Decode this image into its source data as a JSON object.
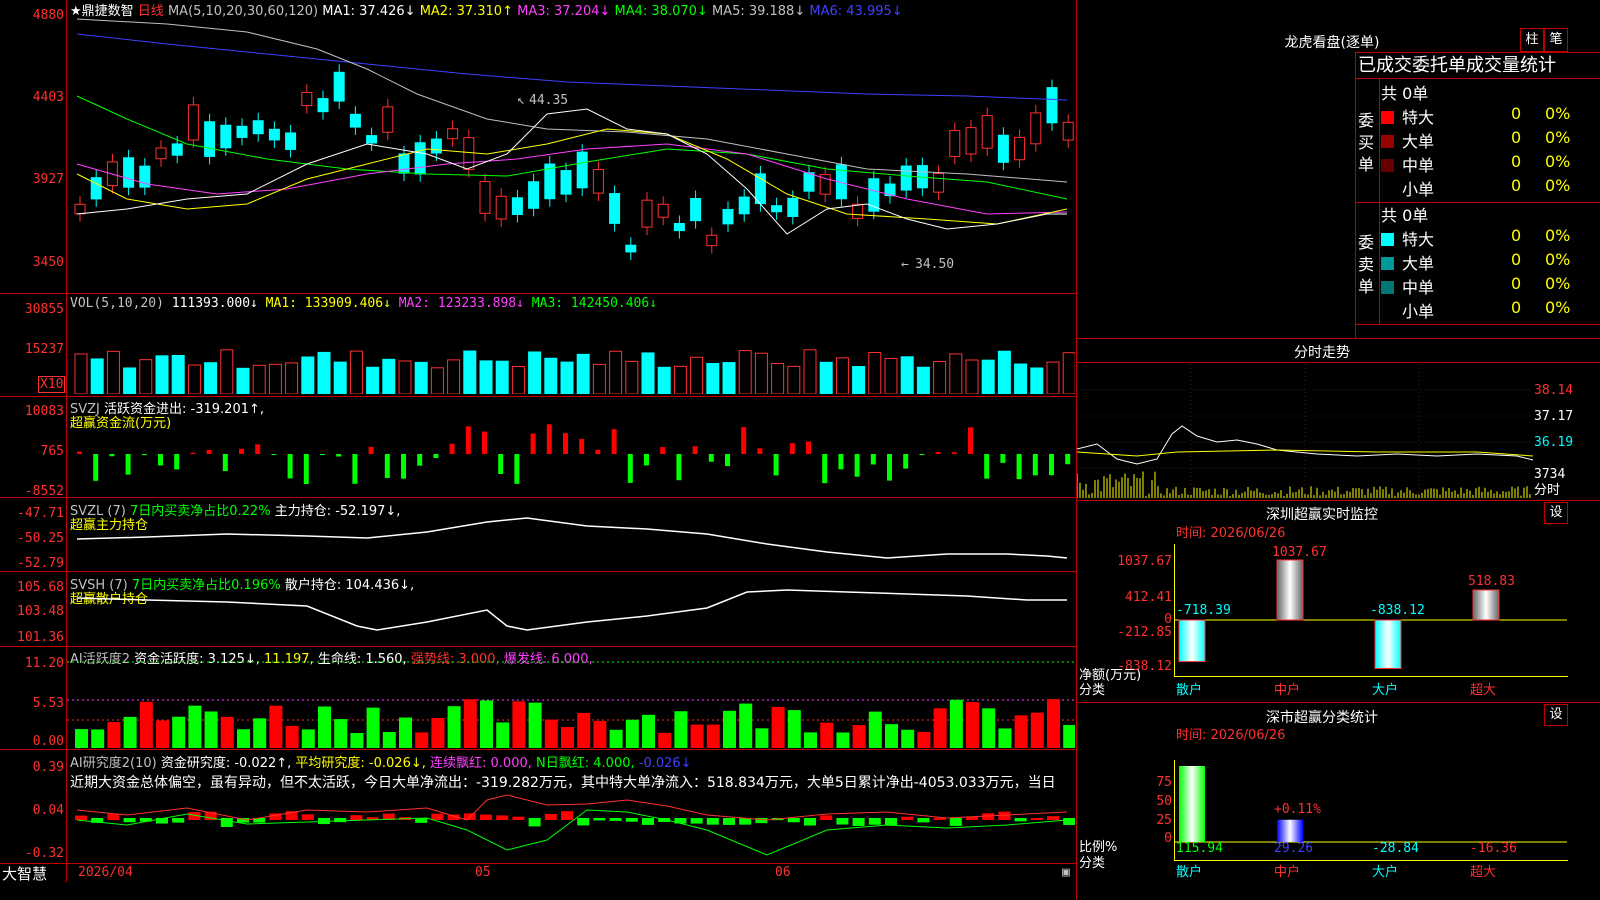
{
  "main": {
    "title": "★鼎捷数智",
    "period": "日线",
    "ma_params": "MA(5,10,20,30,60,120)",
    "ma_values": [
      {
        "label": "MA1: 37.426↓",
        "color": "#ffffff"
      },
      {
        "label": "MA2: 37.310↑",
        "color": "#ffff00"
      },
      {
        "label": "MA3: 37.204↓",
        "color": "#ff40ff"
      },
      {
        "label": "MA4: 38.070↓",
        "color": "#00ff00"
      },
      {
        "label": "MA5: 39.188↓",
        "color": "#c0c0c0"
      },
      {
        "label": "MA6: 43.995↓",
        "color": "#4040ff"
      }
    ],
    "y_labels": [
      "4880",
      "4403",
      "3927",
      "3450"
    ],
    "high_label": "44.35",
    "low_label": "34.50"
  },
  "vol": {
    "header": "VOL(5,10,20)",
    "value": "111393.000↓",
    "ma1": "MA1: 133909.406↓",
    "ma2": "MA2: 123233.898↓",
    "ma3": "MA3: 142450.406↓",
    "y_labels": [
      "30855",
      "15237"
    ],
    "unit": "X10"
  },
  "svzj": {
    "header": "SVZJ",
    "line1": "活跃资金进出: -319.201↑,",
    "line2": "超赢资金流(万元)",
    "y_labels": [
      "10083",
      "765",
      "-8552"
    ]
  },
  "svzl": {
    "header": "SVZL  (7)",
    "desc": "7日内买卖净占比0.22%",
    "val": "主力持仓: -52.197↓,",
    "line2": "超赢主力持仓",
    "y_labels": [
      "-47.71",
      "-50.25",
      "-52.79"
    ]
  },
  "svsh": {
    "header": "SVSH  (7)",
    "desc": "7日内买卖净占比0.196%",
    "val": "散户持仓: 104.436↓,",
    "line2": "超赢散户持仓",
    "y_labels": [
      "105.68",
      "103.48",
      "101.36"
    ]
  },
  "ai1": {
    "header": "AI活跃度2",
    "val1": "资金活跃度: 3.125↓,",
    "val2": "11.197,",
    "val3": "生命线: 1.560,",
    "val4": "强势线: 3.000,",
    "val5": "爆发线: 6.000,",
    "y_labels": [
      "11.20",
      "5.53",
      "0.00"
    ]
  },
  "ai2": {
    "header": "AI研究度2(10)",
    "val1": "资金研究度: -0.022↑,",
    "val2": "平均研究度: -0.026↓,",
    "val3": "连续飘红: 0.000,",
    "val4": "N日飘红: 4.000,",
    "val5": "-0.026↓",
    "summary": "近期大资金总体偏空，虽有异动，但不太活跃，今日大单净流出：-319.282万元，其中特大单净流入：518.834万元，大单5日累计净出-4053.033万元，当日",
    "y_labels": [
      "0.39",
      "0.04",
      "-0.32"
    ]
  },
  "xaxis": {
    "labels": [
      "2026/04",
      "05",
      "06"
    ]
  },
  "brand": "大智慧",
  "right": {
    "dragon": {
      "title": "龙虎看盘(逐单)",
      "btn1": "柱",
      "btn2": "笔",
      "subtitle": "已成交委托单成交量统计",
      "buy_label": "委买单",
      "sell_label": "委卖单",
      "buy_total": "共 0单",
      "sell_total": "共 0单",
      "buy_rows": [
        {
          "name": "特大",
          "count": "0",
          "pct": "0%",
          "color": "#ff0000"
        },
        {
          "name": "大单",
          "count": "0",
          "pct": "0%",
          "color": "#990000"
        },
        {
          "name": "中单",
          "count": "0",
          "pct": "0%",
          "color": "#660000"
        },
        {
          "name": "小单",
          "count": "0",
          "pct": "0%",
          "color": "#000000"
        }
      ],
      "sell_rows": [
        {
          "name": "特大",
          "count": "0",
          "pct": "0%",
          "color": "#00ffff"
        },
        {
          "name": "大单",
          "count": "0",
          "pct": "0%",
          "color": "#009999"
        },
        {
          "name": "中单",
          "count": "0",
          "pct": "0%",
          "color": "#007777"
        },
        {
          "name": "小单",
          "count": "0",
          "pct": "0%",
          "color": "#000000"
        }
      ]
    },
    "intraday": {
      "title": "分时走势",
      "y_labels": [
        "38.14",
        "37.17",
        "36.19",
        "3734"
      ],
      "corner_label": "分时"
    },
    "monitor": {
      "title": "深圳超赢实时监控",
      "btn": "设",
      "time": "时间: 2026/06/26",
      "y_labels": [
        "1037.67",
        "412.41",
        "0",
        "-212.85",
        "-838.12"
      ],
      "unit_label": "净额(万元)",
      "cat_label": "分类",
      "categories": [
        "散户",
        "中户",
        "大户",
        "超大"
      ],
      "values": [
        "-718.39",
        "1037.67",
        "-838.12",
        "518.83"
      ]
    },
    "classify": {
      "title": "深市超赢分类统计",
      "btn": "设",
      "time": "时间: 2026/06/26",
      "y_labels": [
        "75",
        "50",
        "25",
        "0"
      ],
      "unit_label": "比例%",
      "cat_label": "分类",
      "categories": [
        "散户",
        "中户",
        "大户",
        "超大"
      ],
      "values": [
        "115.94",
        "29.26",
        "-28.84",
        "-16.36"
      ],
      "bar_label": "+0.11%"
    }
  }
}
